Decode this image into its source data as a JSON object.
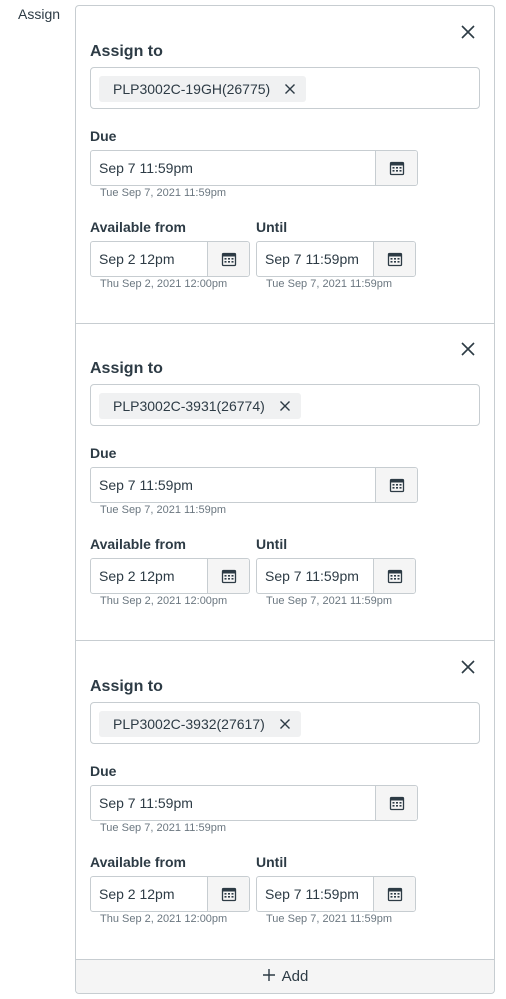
{
  "assign_label": "Assign",
  "add_label": "Add",
  "cards": [
    {
      "assign_to_label": "Assign to",
      "assignee": "PLP3002C-19GH(26775)",
      "due_label": "Due",
      "due_value": "Sep 7 11:59pm",
      "due_hint": "Tue Sep 7, 2021 11:59pm",
      "available_from_label": "Available from",
      "available_from_value": "Sep 2 12pm",
      "available_from_hint": "Thu Sep 2, 2021 12:00pm",
      "until_label": "Until",
      "until_value": "Sep 7 11:59pm",
      "until_hint": "Tue Sep 7, 2021 11:59pm"
    },
    {
      "assign_to_label": "Assign to",
      "assignee": "PLP3002C-3931(26774)",
      "due_label": "Due",
      "due_value": "Sep 7 11:59pm",
      "due_hint": "Tue Sep 7, 2021 11:59pm",
      "available_from_label": "Available from",
      "available_from_value": "Sep 2 12pm",
      "available_from_hint": "Thu Sep 2, 2021 12:00pm",
      "until_label": "Until",
      "until_value": "Sep 7 11:59pm",
      "until_hint": "Tue Sep 7, 2021 11:59pm"
    },
    {
      "assign_to_label": "Assign to",
      "assignee": "PLP3002C-3932(27617)",
      "due_label": "Due",
      "due_value": "Sep 7 11:59pm",
      "due_hint": "Tue Sep 7, 2021 11:59pm",
      "available_from_label": "Available from",
      "available_from_value": "Sep 2 12pm",
      "available_from_hint": "Thu Sep 2, 2021 12:00pm",
      "until_label": "Until",
      "until_value": "Sep 7 11:59pm",
      "until_hint": "Tue Sep 7, 2021 11:59pm"
    }
  ],
  "icons": {
    "close": "close-icon",
    "remove": "remove-icon",
    "calendar": "calendar-icon",
    "plus": "plus-icon"
  }
}
